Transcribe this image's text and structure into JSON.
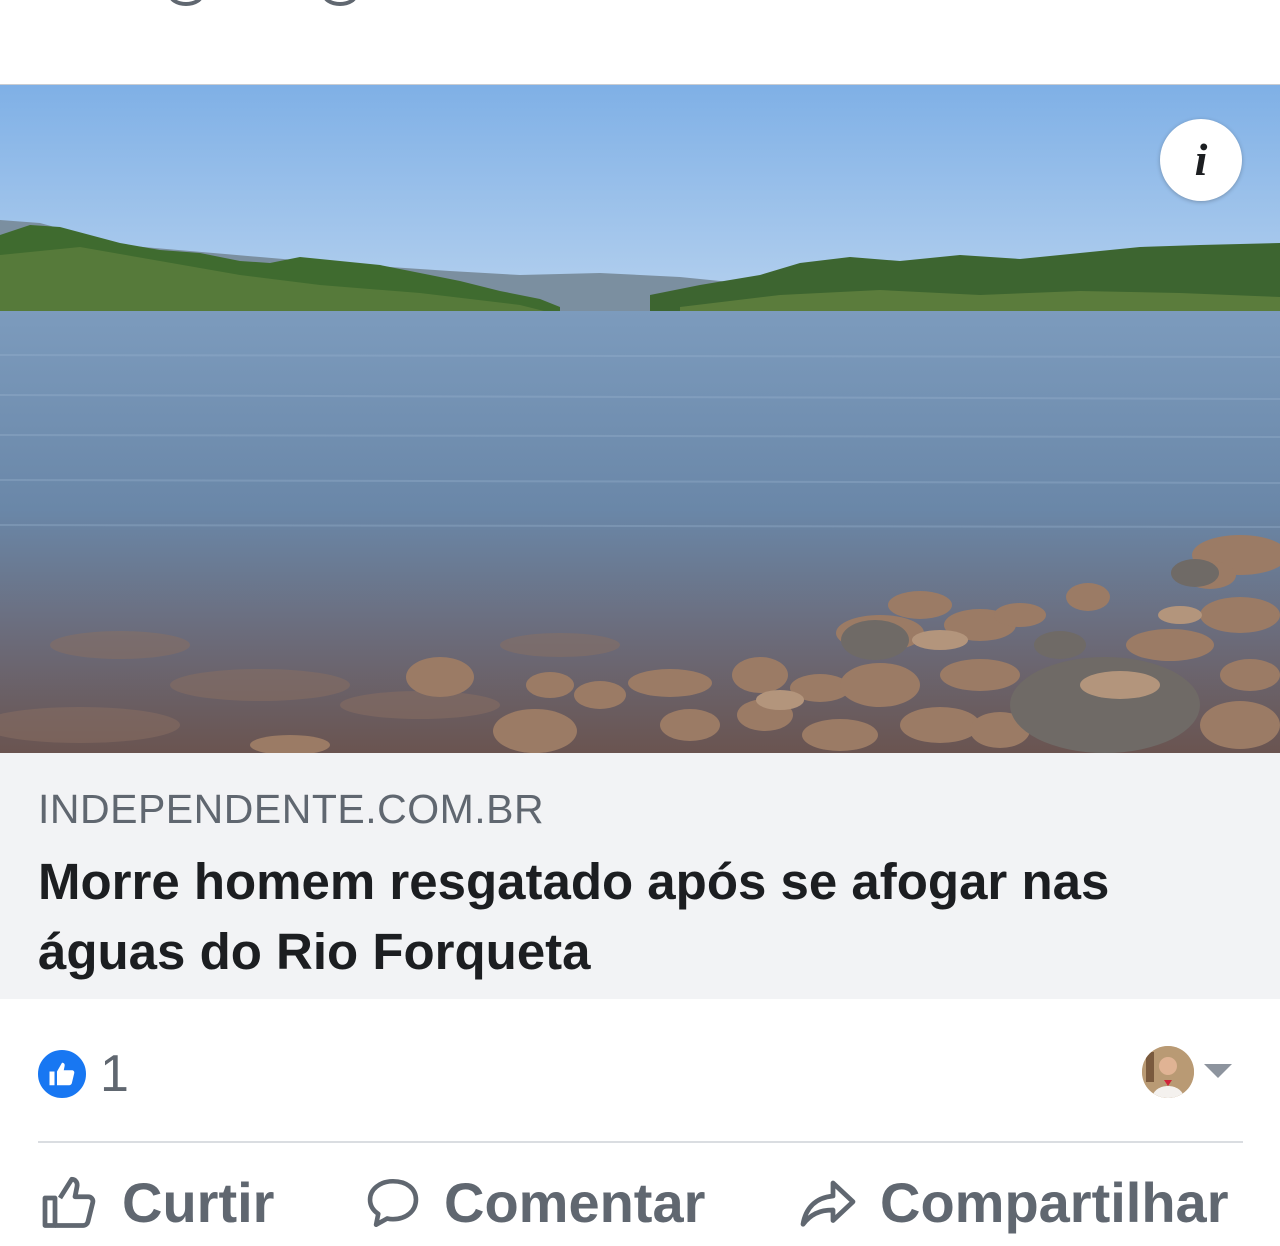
{
  "post": {
    "link_card": {
      "domain": "INDEPENDENTE.COM.BR",
      "headline": "Morre homem resgatado após se afogar nas águas do Rio Forqueta",
      "info_button_glyph": "i",
      "image_alt": "Rio Forqueta"
    },
    "reactions": {
      "like_count": "1",
      "reaction_icon": "thumbs-up-icon"
    },
    "actions": {
      "like_label": "Curtir",
      "comment_label": "Comentar",
      "share_label": "Compartilhar"
    }
  },
  "colors": {
    "facebook_blue": "#1877f2",
    "caption_bg": "#f2f3f5",
    "muted_text": "#606770",
    "divider": "#dadde1"
  }
}
